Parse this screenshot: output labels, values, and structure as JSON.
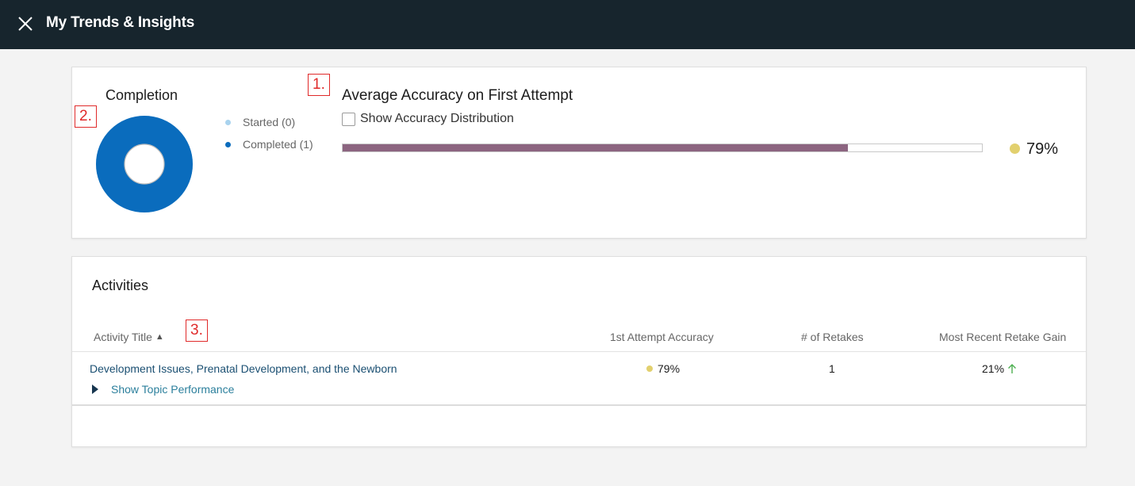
{
  "header": {
    "title": "My Trends & Insights"
  },
  "annotations": [
    "1.",
    "2.",
    "3."
  ],
  "completion": {
    "title": "Completion",
    "started_label": "Started (0)",
    "completed_label": "Completed (1)",
    "started": 0,
    "completed": 1,
    "colors": {
      "started": "#a9d3ee",
      "completed": "#0a6cbd"
    }
  },
  "accuracy": {
    "title": "Average Accuracy on First Attempt",
    "distribution_label": "Show Accuracy Distribution",
    "distribution_checked": false,
    "value_label": "79%",
    "value": 79,
    "colors": {
      "bar": "#8c6580",
      "dot": "#e2d06e"
    }
  },
  "activities": {
    "title": "Activities",
    "columns": {
      "title": "Activity Title",
      "accuracy": "1st Attempt Accuracy",
      "retakes": "# of Retakes",
      "gain": "Most Recent Retake Gain"
    },
    "rows": [
      {
        "title": "Development Issues, Prenatal Development, and the Newborn",
        "toggle": "Show Topic Performance",
        "accuracy": "79%",
        "retakes": "1",
        "gain": "21%",
        "gain_icon": "arrow-up-icon",
        "gain_color": "#4caf50"
      }
    ]
  }
}
